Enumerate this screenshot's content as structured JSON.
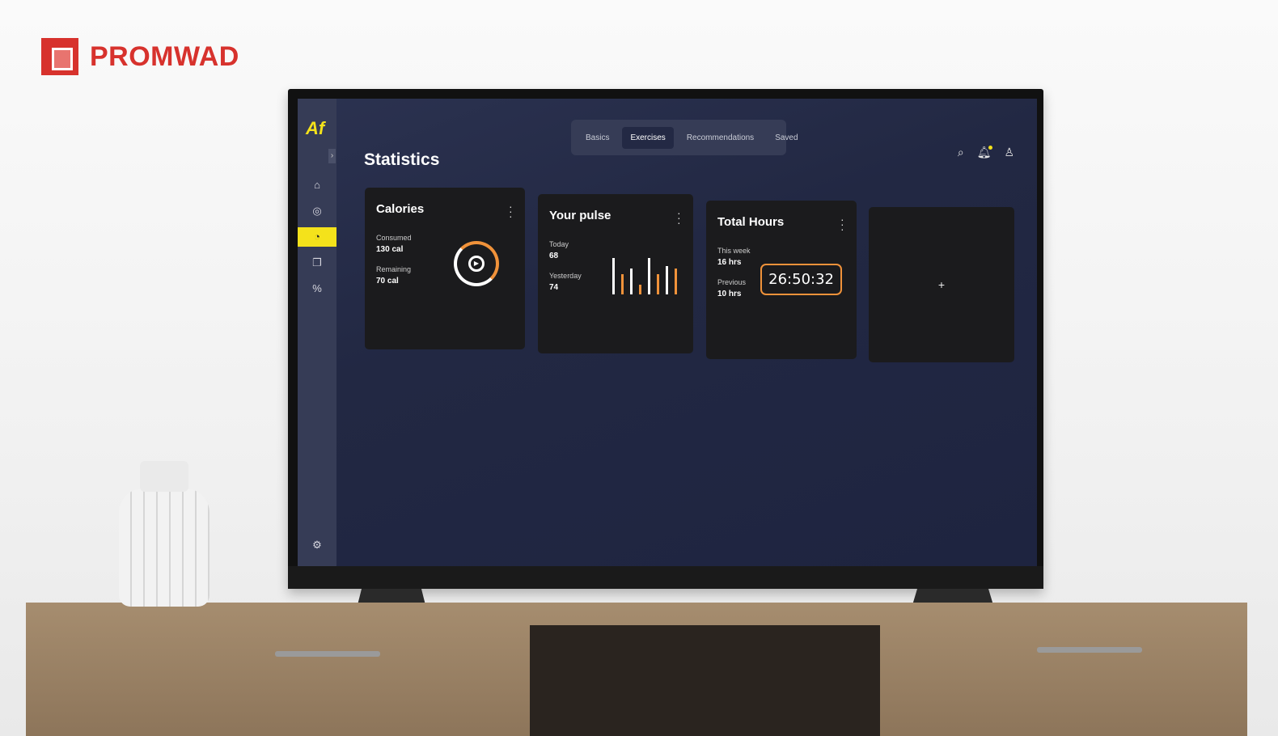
{
  "brand_logo": "PROMWAD",
  "app": {
    "logo": "Af",
    "title": "Statistics",
    "tabs": [
      {
        "label": "Basics"
      },
      {
        "label": "Exercises",
        "active": true
      },
      {
        "label": "Recommendations"
      },
      {
        "label": "Saved"
      }
    ],
    "sidebar": [
      {
        "icon": "home-icon"
      },
      {
        "icon": "check-circle-icon"
      },
      {
        "icon": "pie-chart-icon",
        "active": true
      },
      {
        "icon": "copy-icon"
      },
      {
        "icon": "percent-icon"
      },
      {
        "icon": "gear-icon"
      }
    ],
    "header_icons": [
      "search-icon",
      "bell-icon",
      "user-icon"
    ],
    "cards": {
      "calories": {
        "title": "Calories",
        "consumed_label": "Consumed",
        "consumed": "130 cal",
        "remaining_label": "Remaining",
        "remaining": "70 cal",
        "progress_fraction": 0.35
      },
      "pulse": {
        "title": "Your pulse",
        "today_label": "Today",
        "today": "68",
        "yesterday_label": "Yesterday",
        "yesterday": "74",
        "bars": [
          {
            "v": 0.9,
            "c": "white"
          },
          {
            "v": 0.5,
            "c": "orange"
          },
          {
            "v": 0.65,
            "c": "white"
          },
          {
            "v": 0.25,
            "c": "orange"
          },
          {
            "v": 0.9,
            "c": "white"
          },
          {
            "v": 0.5,
            "c": "orange"
          },
          {
            "v": 0.7,
            "c": "white"
          },
          {
            "v": 0.65,
            "c": "orange"
          }
        ]
      },
      "hours": {
        "title": "Total Hours",
        "week_label": "This week",
        "week": "16 hrs",
        "previous_label": "Previous",
        "previous": "10 hrs",
        "timer": "26:50:32"
      },
      "add": {
        "label": "+"
      }
    }
  },
  "colors": {
    "accent": "#f4e21b",
    "orange": "#f0923a",
    "brand_red": "#d7322d",
    "card": "#1b1b1d"
  }
}
